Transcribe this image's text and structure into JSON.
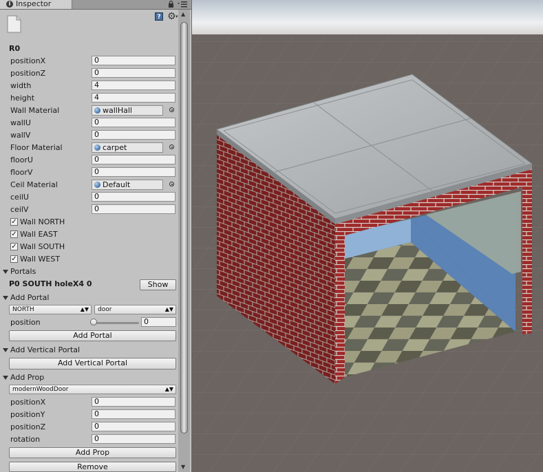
{
  "tab": {
    "title": "Inspector"
  },
  "object": {
    "name": "R0",
    "fields": [
      {
        "label": "positionX",
        "value": "0"
      },
      {
        "label": "positionZ",
        "value": "0"
      },
      {
        "label": "width",
        "value": "4"
      },
      {
        "label": "height",
        "value": "4"
      }
    ],
    "wall_material": {
      "label": "Wall Material",
      "value": "wallHall"
    },
    "wall_uv": [
      {
        "label": "wallU",
        "value": "0"
      },
      {
        "label": "wallV",
        "value": "0"
      }
    ],
    "floor_material": {
      "label": "Floor Material",
      "value": "carpet"
    },
    "floor_uv": [
      {
        "label": "floorU",
        "value": "0"
      },
      {
        "label": "floorV",
        "value": "0"
      }
    ],
    "ceil_material": {
      "label": "Ceil Material",
      "value": "Default"
    },
    "ceil_uv": [
      {
        "label": "ceilU",
        "value": "0"
      },
      {
        "label": "ceilV",
        "value": "0"
      }
    ],
    "walls": [
      {
        "label": "Wall NORTH",
        "checked": true
      },
      {
        "label": "Wall EAST",
        "checked": true
      },
      {
        "label": "Wall SOUTH",
        "checked": true
      },
      {
        "label": "Wall WEST",
        "checked": true
      }
    ]
  },
  "portals": {
    "header": "Portals",
    "item_label": "P0 SOUTH holeX4 0",
    "show_button": "Show"
  },
  "add_portal": {
    "header": "Add Portal",
    "direction": "NORTH",
    "type": "door",
    "position_label": "position",
    "position_value": "0",
    "button": "Add Portal"
  },
  "add_vertical_portal": {
    "header": "Add Vertical Portal",
    "button": "Add Vertical Portal"
  },
  "add_prop": {
    "header": "Add Prop",
    "prop": "modernWoodDoor",
    "fields": [
      {
        "label": "positionX",
        "value": "0"
      },
      {
        "label": "positionY",
        "value": "0"
      },
      {
        "label": "positionZ",
        "value": "0"
      },
      {
        "label": "rotation",
        "value": "0"
      }
    ],
    "button": "Add Prop",
    "remove_button": "Remove"
  },
  "colors": {
    "panel_bg": "#c2c2c2",
    "scene_ground": "#6b6460",
    "brick": "#9e2a2a",
    "interior_wall": "#5b83b5"
  }
}
